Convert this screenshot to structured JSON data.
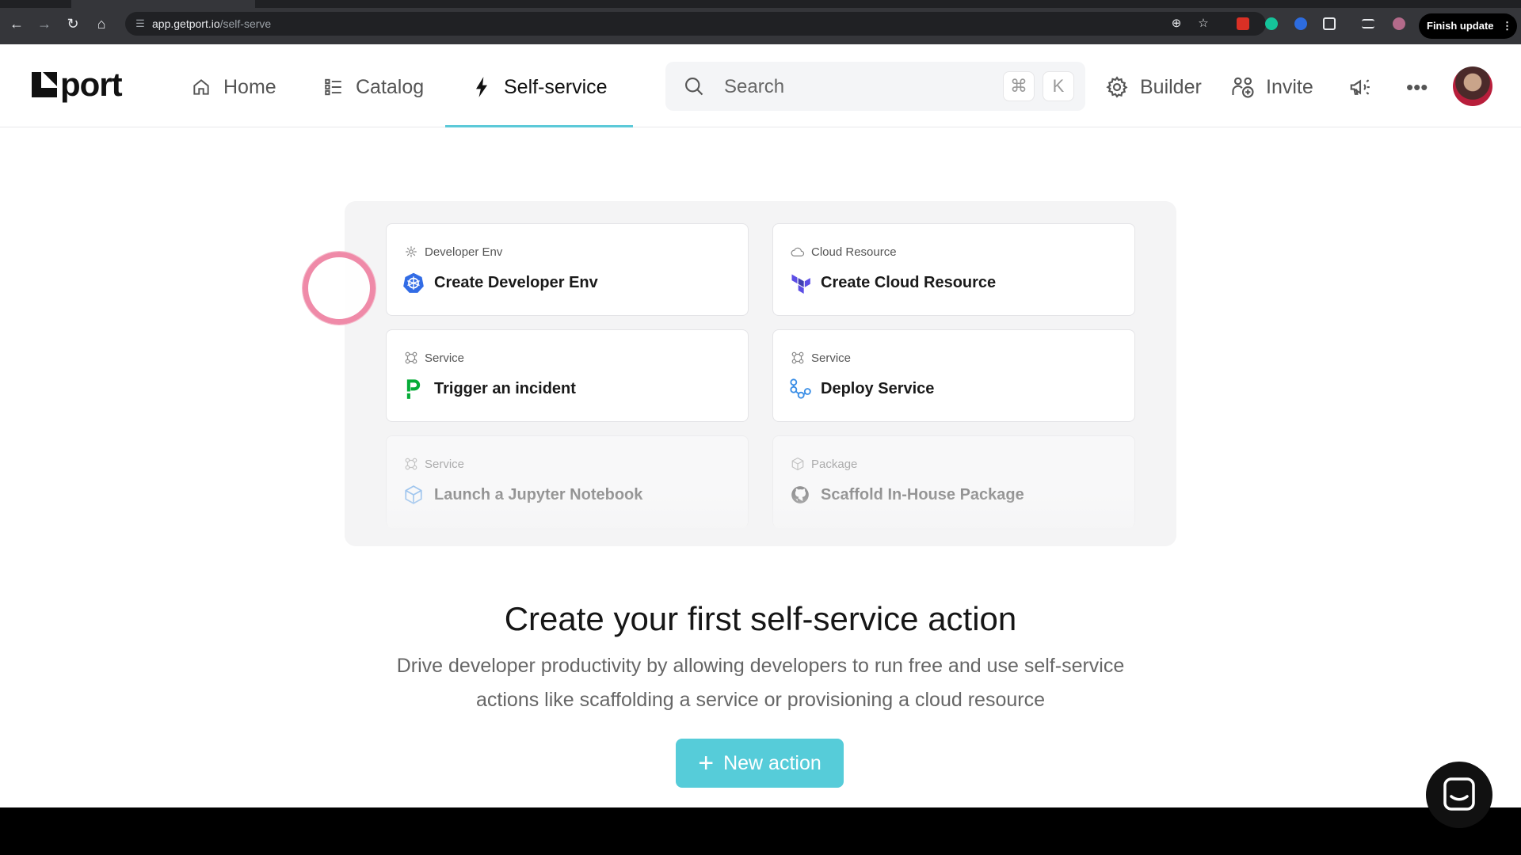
{
  "browser": {
    "url_host": "app.getport.io",
    "url_path": "/self-serve",
    "finish_update_label": "Finish update"
  },
  "app": {
    "logo_text": "port",
    "nav": {
      "home": "Home",
      "catalog": "Catalog",
      "self_service": "Self-service"
    },
    "search": {
      "placeholder": "Search",
      "shortcut_mod": "⌘",
      "shortcut_key": "K"
    },
    "right": {
      "builder": "Builder",
      "invite": "Invite"
    }
  },
  "cards": [
    {
      "category": "Developer Env",
      "title": "Create Developer Env",
      "icon": "kubernetes-icon"
    },
    {
      "category": "Cloud Resource",
      "title": "Create Cloud Resource",
      "icon": "terraform-icon"
    },
    {
      "category": "Service",
      "title": "Trigger an incident",
      "icon": "pagerduty-icon"
    },
    {
      "category": "Service",
      "title": "Deploy Service",
      "icon": "deploy-icon"
    },
    {
      "category": "Service",
      "title": "Launch a Jupyter Notebook",
      "icon": "cube-icon"
    },
    {
      "category": "Package",
      "title": "Scaffold In-House Package",
      "icon": "github-icon"
    }
  ],
  "empty_state": {
    "headline": "Create your first self-service action",
    "subtext": "Drive developer productivity by allowing developers to run free and use self-service actions like scaffolding a service or provisioning a cloud resource",
    "button_label": "New action"
  },
  "colors": {
    "accent": "#56ccd9",
    "click_ring": "#ef8aa8"
  }
}
